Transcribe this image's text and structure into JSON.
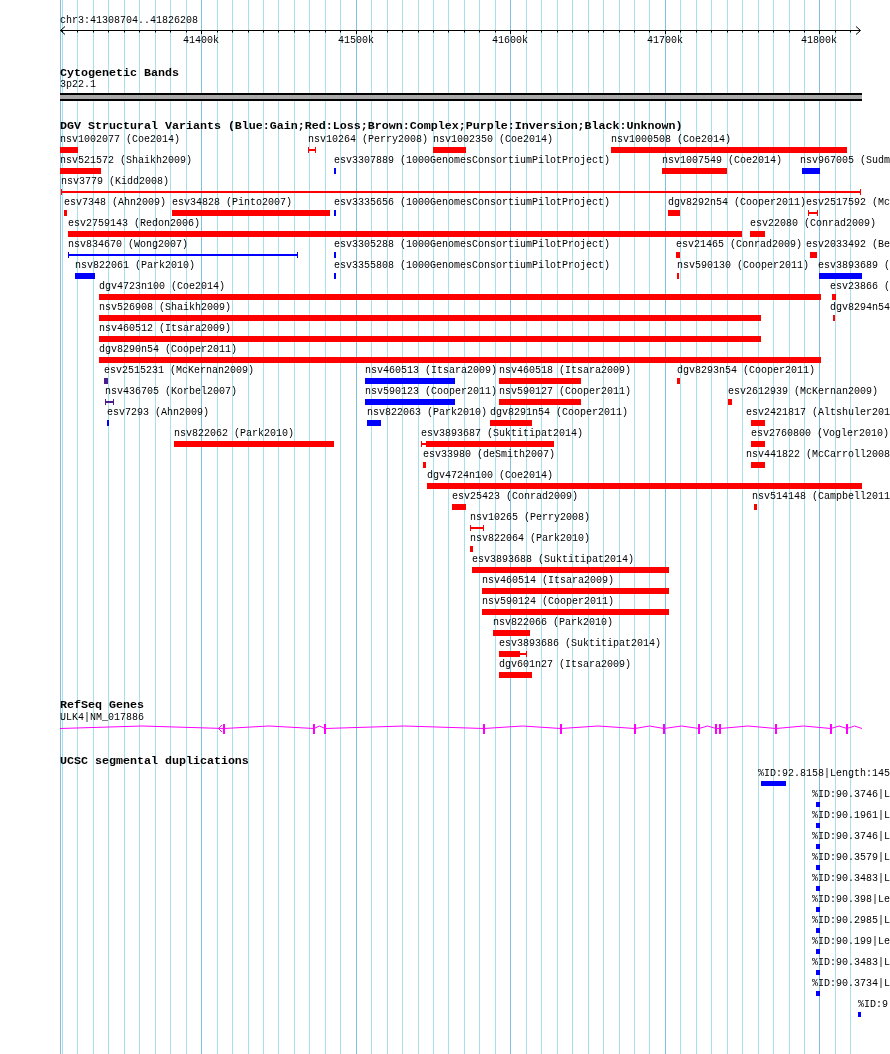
{
  "ruler": {
    "position": "chr3:41308704..41826208",
    "ticks": [
      "41400k",
      "41500k",
      "41600k",
      "41700k",
      "41800k"
    ]
  },
  "tracks": [
    {
      "kind": "cytoband",
      "title": "Cytogenetic Bands",
      "band": "3p22.1"
    },
    {
      "kind": "variants",
      "title": "DGV Structural Variants (Blue:Gain;Red:Loss;Brown:Complex;Purple:Inversion;Black:Unknown)",
      "rows": [
        [
          {
            "label": "nsv1002077 (Coe2014)",
            "color": "#ff0000",
            "kind": "block"
          },
          {
            "label": "nsv10264 (Perry2008)",
            "color": "#ff0000",
            "kind": "range"
          },
          {
            "label": "nsv1002350 (Coe2014)",
            "color": "#ff0000",
            "kind": "block"
          },
          {
            "label": "nsv1000508 (Coe2014)",
            "color": "#ff0000",
            "kind": "block"
          }
        ],
        [
          {
            "label": "nsv521572 (Shaikh2009)",
            "color": "#ff0000",
            "kind": "block"
          },
          {
            "label": "esv3307889 (1000GenomesConsortiumPilotProject)",
            "color": "#0000ff",
            "kind": "block"
          },
          {
            "label": "nsv1007549 (Coe2014)",
            "color": "#ff0000",
            "kind": "block"
          },
          {
            "label": "nsv967005 (Sudm",
            "color": "#0000ff",
            "kind": "block"
          }
        ],
        [
          {
            "label": "nsv3779 (Kidd2008)",
            "color": "#ff0000",
            "kind": "range"
          }
        ],
        [
          {
            "label": "esv7348 (Ahn2009)",
            "color": "#ff0000",
            "kind": "block"
          },
          {
            "label": "esv34828 (Pinto2007)",
            "color": "#ff0000",
            "kind": "block"
          },
          {
            "label": "esv3335656 (1000GenomesConsortiumPilotProject)",
            "color": "#0000ff",
            "kind": "block"
          },
          {
            "label": "dgv8292n54 (Cooper2011)",
            "color": "#ff0000",
            "kind": "block"
          },
          {
            "label": "esv2517592 (Mc",
            "color": "#ff0000",
            "kind": "range"
          }
        ],
        [
          {
            "label": "esv2759143 (Redon2006)",
            "color": "#ff0000",
            "kind": "block"
          },
          {
            "label": "esv22080 (Conrad2009)",
            "color": "#ff0000",
            "kind": "block"
          }
        ],
        [
          {
            "label": "nsv834670 (Wong2007)",
            "color": "#0000ff",
            "kind": "range"
          },
          {
            "label": "esv3305288 (1000GenomesConsortiumPilotProject)",
            "color": "#0000ff",
            "kind": "block"
          },
          {
            "label": "esv21465 (Conrad2009)",
            "color": "#ff0000",
            "kind": "block"
          },
          {
            "label": "esv2033492 (Be",
            "color": "#ff0000",
            "kind": "block"
          }
        ],
        [
          {
            "label": "nsv822061 (Park2010)",
            "color": "#0000ff",
            "kind": "block"
          },
          {
            "label": "esv3355808 (1000GenomesConsortiumPilotProject)",
            "color": "#0000ff",
            "kind": "block"
          },
          {
            "label": "nsv590130 (Cooper2011)",
            "color": "#ff0000",
            "kind": "block"
          },
          {
            "label": "esv3893689 (",
            "color": "#0000ff",
            "kind": "block"
          }
        ],
        [
          {
            "label": "dgv4723n100 (Coe2014)",
            "color": "#ff0000",
            "kind": "block"
          },
          {
            "label": "esv23866 (",
            "color": "#ff0000",
            "kind": "block"
          }
        ],
        [
          {
            "label": "nsv526908 (Shaikh2009)",
            "color": "#ff0000",
            "kind": "block"
          },
          {
            "label": "dgv8294n54",
            "color": "#ff0000",
            "kind": "block"
          }
        ],
        [
          {
            "label": "nsv460512 (Itsara2009)",
            "color": "#ff0000",
            "kind": "block"
          }
        ],
        [
          {
            "label": "dgv8290n54 (Cooper2011)",
            "color": "#ff0000",
            "kind": "block"
          }
        ],
        [
          {
            "label": "esv2515231 (McKernan2009)",
            "color": "#4b1d8c",
            "kind": "block"
          },
          {
            "label": "nsv460513 (Itsara2009)",
            "color": "#0000ff",
            "kind": "block"
          },
          {
            "label": "nsv460518 (Itsara2009)",
            "color": "#ff0000",
            "kind": "block"
          },
          {
            "label": "dgv8293n54 (Cooper2011)",
            "color": "#ff0000",
            "kind": "block"
          }
        ],
        [
          {
            "label": "nsv436705 (Korbel2007)",
            "color": "#4b1d8c",
            "kind": "range"
          },
          {
            "label": "nsv590123 (Cooper2011)",
            "color": "#0000ff",
            "kind": "block"
          },
          {
            "label": "nsv590127 (Cooper2011)",
            "color": "#ff0000",
            "kind": "block"
          },
          {
            "label": "esv2612939 (McKernan2009)",
            "color": "#ff0000",
            "kind": "block"
          }
        ],
        [
          {
            "label": "esv7293 (Ahn2009)",
            "color": "#0000ff",
            "kind": "block"
          },
          {
            "label": "nsv822063 (Park2010)",
            "color": "#0000ff",
            "kind": "block"
          },
          {
            "label": "dgv8291n54 (Cooper2011)",
            "color": "#ff0000",
            "kind": "block"
          },
          {
            "label": "esv2421817 (Altshuler201",
            "color": "#ff0000",
            "kind": "block"
          }
        ],
        [
          {
            "label": "nsv822062 (Park2010)",
            "color": "#ff0000",
            "kind": "block"
          },
          {
            "label": "esv3893687 (Suktitipat2014)",
            "color": "#ff0000",
            "kind": "block"
          },
          {
            "label": "esv2760800 (Vogler2010)",
            "color": "#ff0000",
            "kind": "block"
          }
        ],
        [
          {
            "label": "esv33980 (deSmith2007)",
            "color": "#ff0000",
            "kind": "block"
          },
          {
            "label": "nsv441822 (McCarroll2008",
            "color": "#ff0000",
            "kind": "block"
          }
        ],
        [
          {
            "label": "dgv4724n100 (Coe2014)",
            "color": "#ff0000",
            "kind": "block"
          }
        ],
        [
          {
            "label": "esv25423 (Conrad2009)",
            "color": "#ff0000",
            "kind": "block"
          },
          {
            "label": "nsv514148 (Campbell2011",
            "color": "#ff0000",
            "kind": "block"
          }
        ],
        [
          {
            "label": "nsv10265 (Perry2008)",
            "color": "#ff0000",
            "kind": "range"
          }
        ],
        [
          {
            "label": "nsv822064 (Park2010)",
            "color": "#ff0000",
            "kind": "block"
          }
        ],
        [
          {
            "label": "esv3893688 (Suktitipat2014)",
            "color": "#ff0000",
            "kind": "block"
          }
        ],
        [
          {
            "label": "nsv460514 (Itsara2009)",
            "color": "#ff0000",
            "kind": "block"
          }
        ],
        [
          {
            "label": "nsv590124 (Cooper2011)",
            "color": "#ff0000",
            "kind": "block"
          }
        ],
        [
          {
            "label": "nsv822066 (Park2010)",
            "color": "#ff0000",
            "kind": "block"
          }
        ],
        [
          {
            "label": "esv3893686 (Suktitipat2014)",
            "color": "#ff0000",
            "kind": "block"
          }
        ],
        [
          {
            "label": "dgv601n27 (Itsara2009)",
            "color": "#ff0000",
            "kind": "block"
          }
        ]
      ]
    },
    {
      "kind": "gene",
      "title": "RefSeq Genes",
      "gene": "ULK4|NM_017886"
    },
    {
      "kind": "segdup",
      "title": "UCSC segmental duplications",
      "features": [
        "%ID:92.8158|Length:145",
        "%ID:90.3746|L",
        "%ID:90.1961|L",
        "%ID:90.3746|L",
        "%ID:90.3579|L",
        "%ID:90.3483|L",
        "%ID:90.398|Le",
        "%ID:90.2985|L",
        "%ID:90.199|Le",
        "%ID:90.3483|L",
        "%ID:90.3734|L",
        "%ID:9"
      ]
    }
  ]
}
